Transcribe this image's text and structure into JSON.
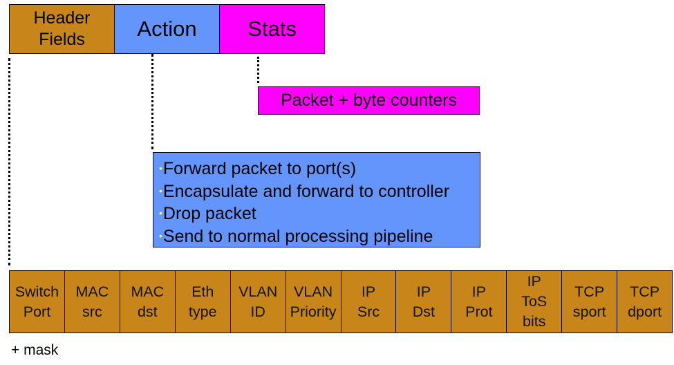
{
  "flow_entry": {
    "header_fields": "Header\nFields",
    "action": "Action",
    "stats": "Stats"
  },
  "stats_detail": "Packet + byte counters",
  "actions": [
    "Forward packet to port(s)",
    "Encapsulate and forward to controller",
    "Drop packet",
    "Send to normal processing pipeline"
  ],
  "header_field_list": [
    "Switch\nPort",
    "MAC\nsrc",
    "MAC\ndst",
    "Eth\ntype",
    "VLAN\nID",
    "VLAN\nPriority",
    "IP\nSrc",
    "IP\nDst",
    "IP\nProt",
    "IP\nToS\nbits",
    "TCP\nsport",
    "TCP\ndport"
  ],
  "mask_note": "+ mask",
  "colors": {
    "header_fields": "#c8861a",
    "action": "#6495fc",
    "stats": "#ff00ff",
    "bullet": "#ffff33"
  }
}
